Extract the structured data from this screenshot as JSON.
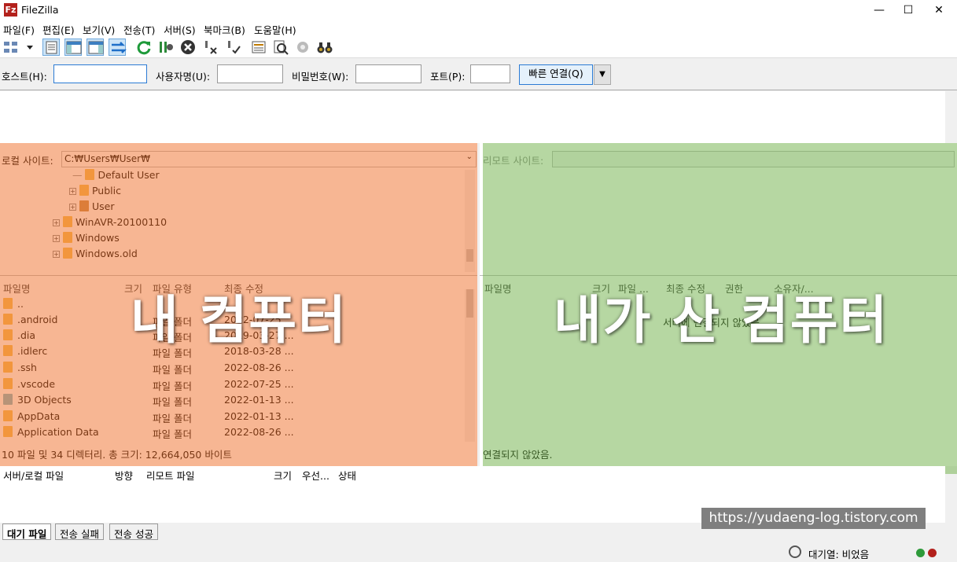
{
  "window": {
    "title": "FileZilla",
    "minimize": "—",
    "maximize": "☐",
    "close": "✕"
  },
  "menu": [
    "파일(F)",
    "편집(E)",
    "보기(V)",
    "전송(T)",
    "서버(S)",
    "북마크(B)",
    "도움말(H)"
  ],
  "toolbar_icons": [
    "site-manager-icon",
    "dropdown-arrow-icon",
    "message-log-toggle-icon",
    "local-tree-toggle-icon",
    "remote-tree-toggle-icon",
    "transfer-queue-toggle-icon",
    "refresh-icon",
    "filter-process-icon",
    "cancel-icon",
    "disconnect-icon",
    "reconnect-icon",
    "directory-listing-filter-icon",
    "compare-icon",
    "sync-browse-icon",
    "search-binoculars-icon"
  ],
  "quickconnect": {
    "host_label": "호스트(H):",
    "host_value": "",
    "user_label": "사용자명(U):",
    "user_value": "",
    "pass_label": "비밀번호(W):",
    "pass_value": "",
    "port_label": "포트(P):",
    "port_value": "",
    "connect_label": "빠른 연결(Q)"
  },
  "local": {
    "site_label": "로컬 사이트:",
    "site_path": "C:₩Users₩User₩",
    "tree": [
      {
        "label": "Default User",
        "indent": 2,
        "expander": ""
      },
      {
        "label": "Public",
        "indent": 2,
        "expander": "+"
      },
      {
        "label": "User",
        "indent": 2,
        "expander": "+",
        "user": true
      },
      {
        "label": "WinAVR-20100110",
        "indent": 1,
        "expander": "+"
      },
      {
        "label": "Windows",
        "indent": 1,
        "expander": "+"
      },
      {
        "label": "Windows.old",
        "indent": 1,
        "expander": "+"
      }
    ],
    "columns": [
      "파일명",
      "크기",
      "파일 유형",
      "최종 수정"
    ],
    "files": [
      {
        "name": "..",
        "type": "",
        "modified": ""
      },
      {
        "name": ".android",
        "type": "파일 폴더",
        "modified": "2022-07-25 ..."
      },
      {
        "name": ".dia",
        "type": "파일 폴더",
        "modified": "2019-03-27 ..."
      },
      {
        "name": ".idlerc",
        "type": "파일 폴더",
        "modified": "2018-03-28 ..."
      },
      {
        "name": ".ssh",
        "type": "파일 폴더",
        "modified": "2022-08-26 ..."
      },
      {
        "name": ".vscode",
        "type": "파일 폴더",
        "modified": "2022-07-25 ..."
      },
      {
        "name": "3D Objects",
        "type": "파일 폴더",
        "modified": "2022-01-13 ..."
      },
      {
        "name": "AppData",
        "type": "파일 폴더",
        "modified": "2022-01-13 ..."
      },
      {
        "name": "Application Data",
        "type": "파일 폴더",
        "modified": "2022-08-26 ..."
      }
    ],
    "status": "10 파일 및 34 디렉터리. 총 크기: 12,664,050 바이트",
    "overlay_label": "내 컴퓨터"
  },
  "remote": {
    "site_label": "리모트 사이트:",
    "site_path": "",
    "columns": [
      "파일명",
      "크기",
      "파일 ...",
      "최종 수정",
      "권한",
      "소유자/..."
    ],
    "empty_message": "서버에 연결되지 않았음",
    "status": "연결되지 않았음.",
    "overlay_label": "내가 산 컴퓨터"
  },
  "queue": {
    "columns": [
      "서버/로컬 파일",
      "방향",
      "리모트 파일",
      "크기",
      "우선...",
      "상태"
    ],
    "tabs": [
      "대기 파일",
      "전송 실패",
      "전송 성공"
    ]
  },
  "statusbar": {
    "queue_text": "대기열: 비었음"
  },
  "watermark": "https://yudaeng-log.tistory.com",
  "colors": {
    "local_overlay": "#f06e28",
    "remote_overlay": "#6eaf46",
    "folder": "#f4bf52"
  }
}
